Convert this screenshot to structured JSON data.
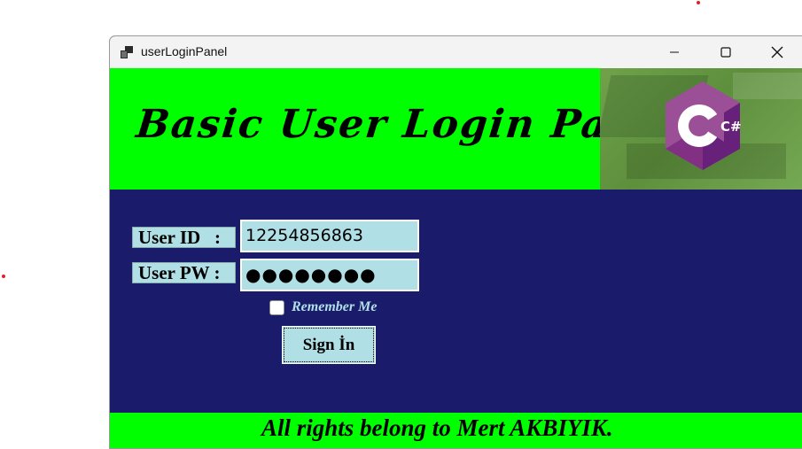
{
  "window": {
    "title": "userLoginPanel"
  },
  "titlebar": {
    "minimize_icon": "minimize-icon",
    "maximize_icon": "maximize-icon",
    "close_icon": "close-icon"
  },
  "header": {
    "title": "Basic User Login Page",
    "logo_icon": "csharp-logo-icon",
    "logo_text": "C#"
  },
  "form": {
    "userid_label": "User ID   :",
    "userid_value": "12254856863",
    "userpw_label": "User PW :",
    "userpw_value": "●●●●●●●●",
    "remember_label": "Remember Me",
    "remember_checked": false,
    "signin_label": "Sign İn"
  },
  "footer": {
    "text": "All rights belong to Mert AKBIYIK."
  },
  "colors": {
    "header_bg": "#00ff00",
    "form_bg": "#1b1b6b",
    "field_bg": "#b0e0e6",
    "footer_bg": "#00ff00"
  }
}
